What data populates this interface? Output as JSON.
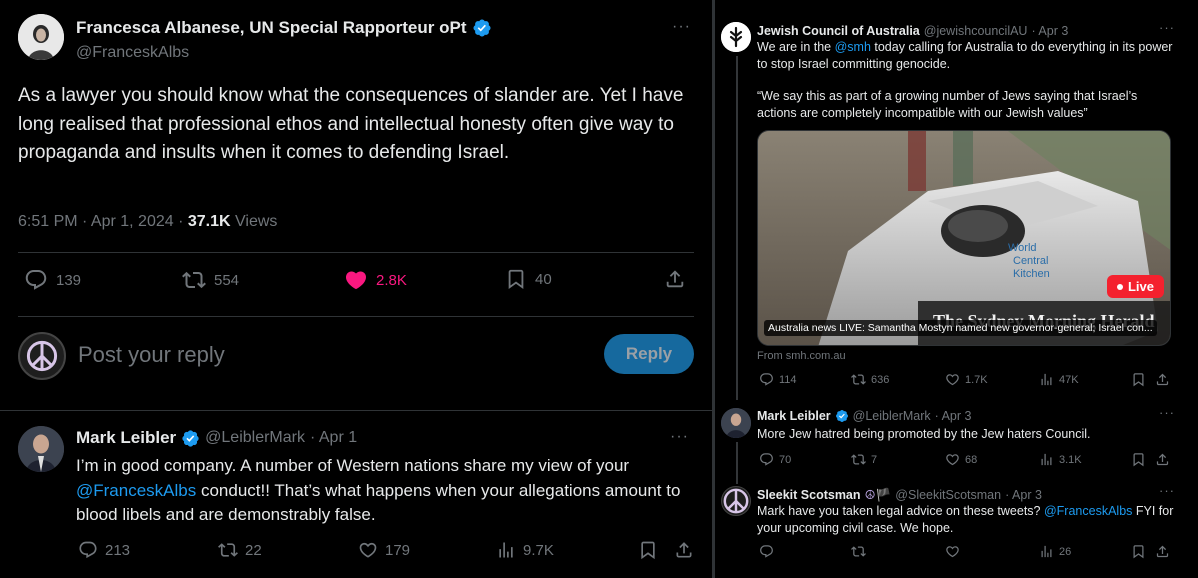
{
  "main_tweet": {
    "name": "Francesca Albanese, UN Special Rapporteur oPt",
    "handle": "@FranceskAlbs",
    "text": "As a lawyer you should know what the consequences of slander are. Yet I have long realised that professional ethos and intellectual honesty often give way to propaganda and insults when it comes to defending Israel.",
    "time": "6:51 PM · Apr 1, 2024 · ",
    "views_count": "37.1K",
    "views_label": " Views",
    "replies": "139",
    "retweets": "554",
    "likes": "2.8K",
    "bookmarks": "40"
  },
  "reply_box": {
    "placeholder": "Post your reply",
    "button": "Reply"
  },
  "reply_tweet": {
    "name": "Mark Leibler",
    "handle": "@LeiblerMark",
    "date": "· Apr 1",
    "text_before": "I’m in good company. A number of Western nations share my view of your ",
    "mention": "@FranceskAlbs",
    "text_after": " conduct!! That’s what happens when your allegations amount to blood libels and are demonstrably false.",
    "replies": "213",
    "retweets": "22",
    "likes": "179",
    "views": "9.7K"
  },
  "right_tweets": {
    "jca": {
      "name": "Jewish Council of Australia",
      "handle": "@jewishcouncilAU",
      "date": "· Apr 3",
      "text_a": "We are in the ",
      "mention": "@smh",
      "text_b": " today calling for Australia to do everything in its power to stop Israel committing genocide.",
      "quote": "“We say this as part of a growing number of Jews saying that Israel’s actions are completely incompatible with our Jewish values”",
      "card_caption": "Australia news LIVE: Samantha Mostyn named new governor-general; Israel con...",
      "card_live": "Live",
      "card_masthead": "The Sydney Morning Herald",
      "card_vehicle_text": "World Central Kitchen",
      "from": "From smh.com.au",
      "replies": "114",
      "retweets": "636",
      "likes": "1.7K",
      "views": "47K"
    },
    "mark": {
      "name": "Mark Leibler",
      "handle": "@LeiblerMark",
      "date": "· Apr 3",
      "text": "More Jew hatred being promoted by the Jew haters Council.",
      "replies": "70",
      "retweets": "7",
      "likes": "68",
      "views": "3.1K"
    },
    "sleekit": {
      "name": "Sleekit Scotsman",
      "emoji": "☮🏴",
      "handle": "@SleekitScotsman",
      "date": "· Apr 3",
      "text_a": "Mark have you taken legal advice on these tweets? ",
      "mention": "@FranceskAlbs",
      "text_b": " FYI for your upcoming civil case. We hope.",
      "views": "26"
    }
  },
  "colors": {
    "background": "#000000",
    "text": "#e7e9ea",
    "muted": "#71767b",
    "accent": "#1d9bf0",
    "like_active": "#f91880",
    "reply_button": "#16699e",
    "live": "#f4212e"
  },
  "icons": [
    "verified-badge-icon",
    "more-icon",
    "reply-icon",
    "retweet-icon",
    "like-icon",
    "bookmark-icon",
    "share-icon",
    "views-icon",
    "peace-icon"
  ]
}
